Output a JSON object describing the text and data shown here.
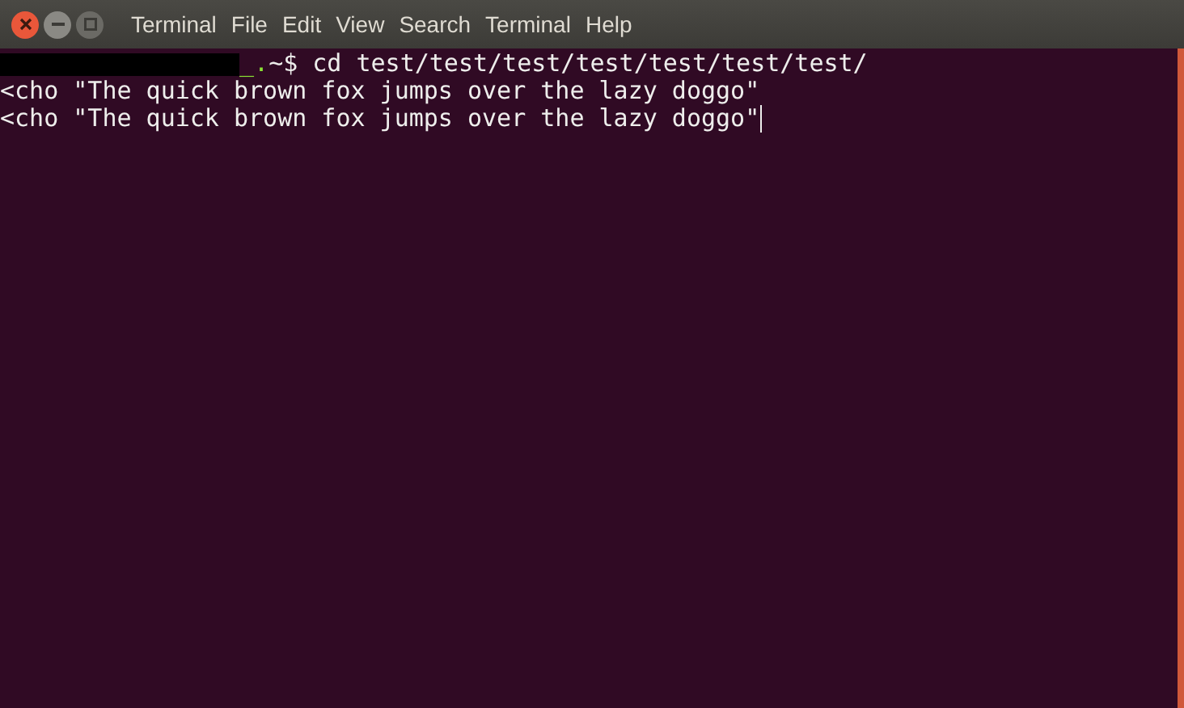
{
  "menu": [
    "Terminal",
    "File",
    "Edit",
    "View",
    "Search",
    "Terminal",
    "Help"
  ],
  "prompt": {
    "host": "_.",
    "command": "~$ cd test/test/test/test/test/test/test/"
  },
  "lines": [
    "<cho \"The quick brown fox jumps over the lazy doggo\"",
    "<cho \"The quick brown fox jumps over the lazy doggo\""
  ]
}
